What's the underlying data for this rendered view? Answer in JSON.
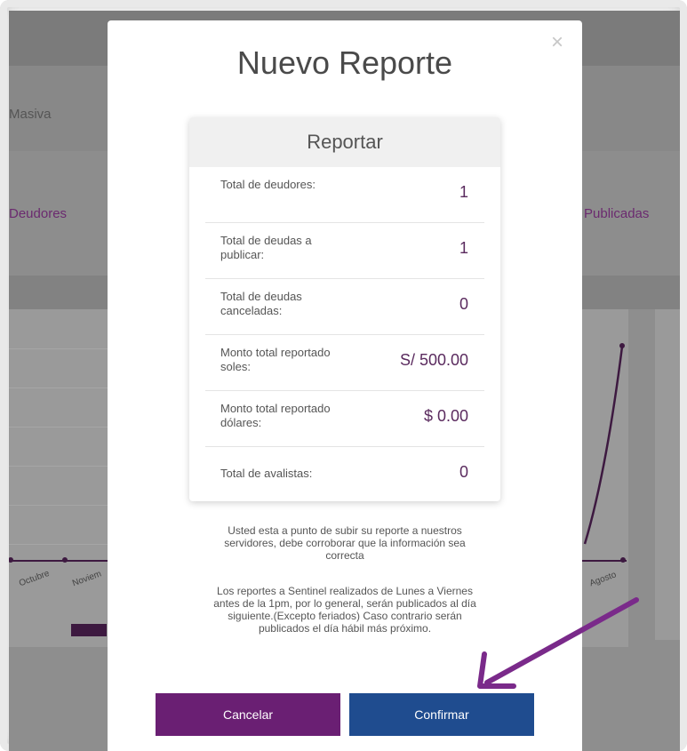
{
  "background": {
    "masiva_label": "Masiva",
    "deudores_label": "Deudores",
    "publicadas_label": "Publicadas",
    "chart_months": [
      "Octubre",
      "Noviem",
      "Agosto"
    ]
  },
  "modal": {
    "title": "Nuevo Reporte",
    "close_symbol": "×",
    "card": {
      "header": "Reportar",
      "rows": [
        {
          "label": "Total de deudores:",
          "value": "1"
        },
        {
          "label": "Total de deudas a publicar:",
          "value": "1"
        },
        {
          "label": "Total de deudas canceladas:",
          "value": "0"
        },
        {
          "label": "Monto total reportado soles:",
          "value": "S/ 500.00"
        },
        {
          "label": "Monto total reportado dólares:",
          "value": "$ 0.00"
        },
        {
          "label": "Total de avalistas:",
          "value": "0"
        }
      ]
    },
    "notice_1": "Usted esta a punto de subir su reporte a nuestros servidores, debe corroborar que la información sea correcta",
    "notice_2": "Los reportes a Sentinel realizados de Lunes a Viernes antes de la 1pm, por lo general, serán publicados al día siguiente.(Excepto feriados) Caso contrario serán publicados el día hábil más próximo.",
    "cancel_label": "Cancelar",
    "confirm_label": "Confirmar"
  },
  "colors": {
    "cancel": "#6a1f73",
    "confirm": "#1f4c8f",
    "annotation_arrow": "#7a2a8a"
  },
  "icons": [
    "close-icon",
    "annotation-arrow-icon"
  ]
}
